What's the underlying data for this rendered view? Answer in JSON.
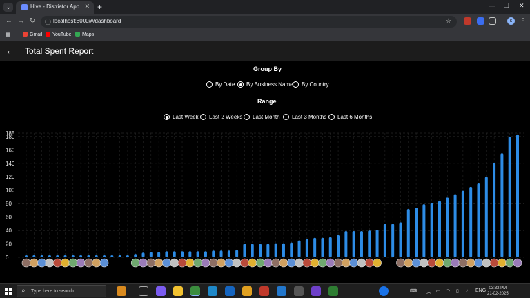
{
  "browser": {
    "tab_title": "Hive - Distriator App",
    "url": "localhost:8000/#/dashboard",
    "bookmarks": [
      {
        "label": "Gmail",
        "color": "#ea4335"
      },
      {
        "label": "YouTube",
        "color": "#ff0000"
      },
      {
        "label": "Maps",
        "color": "#34a853"
      }
    ],
    "profile_initial": "s"
  },
  "app": {
    "title": "Total Spent Report"
  },
  "group_by": {
    "title": "Group By",
    "options": [
      "By Date",
      "By Business Name",
      "By Country"
    ],
    "selected": "By Business Name"
  },
  "range": {
    "title": "Range",
    "options": [
      "Last Week",
      "Last 2 Weeks",
      "Last Month",
      "Last 3 Months",
      "Last 6 Months"
    ],
    "selected": "Last Week"
  },
  "colors": {
    "bar": "#2d8ce6",
    "background": "#000000"
  },
  "chart_data": {
    "type": "bar",
    "y_ticks": [
      0,
      20,
      40,
      60,
      80,
      100,
      120,
      140,
      160,
      180,
      185
    ],
    "ylim": [
      0,
      185
    ],
    "grid": true,
    "values": [
      0.5,
      0.5,
      0.5,
      0.5,
      0.5,
      0.5,
      0.5,
      0.5,
      0.5,
      1,
      2,
      3,
      3,
      3,
      5,
      7,
      8,
      8,
      9,
      9,
      9,
      9,
      9,
      9,
      10,
      10,
      10,
      11,
      20,
      20,
      20,
      20,
      21,
      21,
      22,
      25,
      27,
      29,
      29,
      30,
      33,
      39,
      39,
      39,
      40,
      41,
      50,
      50,
      52,
      72,
      74,
      79,
      81,
      84,
      89,
      94,
      99,
      105,
      110,
      120,
      140,
      155,
      180,
      183
    ],
    "x_category_icons": "business logos (not labelled with text)"
  },
  "taskbar": {
    "search_placeholder": "Type here to search",
    "language": "ENG",
    "time": "03:32 PM",
    "date": "21-02-2025"
  }
}
